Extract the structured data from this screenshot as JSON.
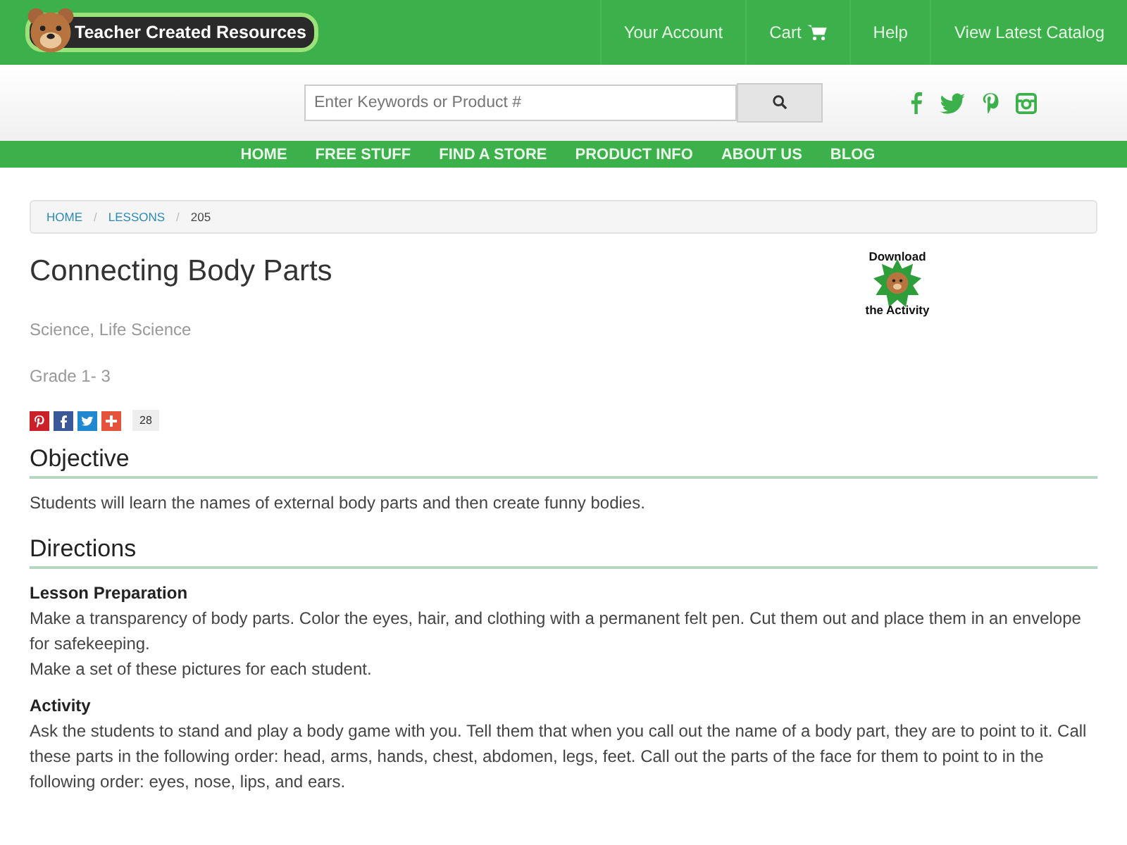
{
  "header": {
    "logo_text": "Teacher Created Resources",
    "links": [
      {
        "label": "Your Account",
        "kind": "text"
      },
      {
        "label": "Cart",
        "kind": "cart"
      },
      {
        "label": "Help",
        "kind": "text"
      },
      {
        "label": "View Latest Catalog",
        "kind": "text"
      }
    ]
  },
  "search": {
    "placeholder": "Enter Keywords or Product #"
  },
  "nav": [
    "HOME",
    "FREE STUFF",
    "FIND A STORE",
    "PRODUCT INFO",
    "ABOUT US",
    "BLOG"
  ],
  "breadcrumb_separator": "/",
  "breadcrumb": [
    {
      "label": "HOME",
      "kind": "link"
    },
    {
      "label": "LESSONS",
      "kind": "link"
    },
    {
      "label": "205",
      "kind": "current"
    }
  ],
  "title": "Connecting Body Parts",
  "subject": "Science, Life Science",
  "grade": "Grade 1- 3",
  "download": {
    "line_1": "Download",
    "line_2": "the Activity"
  },
  "share": {
    "count": "28"
  },
  "sections": [
    {
      "heading": "Objective",
      "blocks": [
        {
          "kind": "paragraph",
          "text": "Students will learn the names of external body parts and then create funny bodies."
        }
      ]
    },
    {
      "heading": "Directions",
      "blocks": [
        {
          "kind": "subheading",
          "text": "Lesson Preparation"
        },
        {
          "kind": "paragraph",
          "text": "Make a transparency of body parts. Color the eyes, hair, and clothing with a permanent felt pen. Cut them out and place them in an envelope for safekeeping."
        },
        {
          "kind": "paragraph",
          "text": "Make a set of these pictures for each student."
        },
        {
          "kind": "subheading",
          "text": "Activity"
        },
        {
          "kind": "paragraph",
          "text": "Ask the students to stand and play a body game with you. Tell them that when you call out the name of a body part, they are to point to it. Call these parts in the following order: head, arms, hands, chest, abdomen, legs, feet. Call out the parts of the face for them to point to in the following order: eyes, nose, lips, and ears."
        }
      ]
    }
  ]
}
